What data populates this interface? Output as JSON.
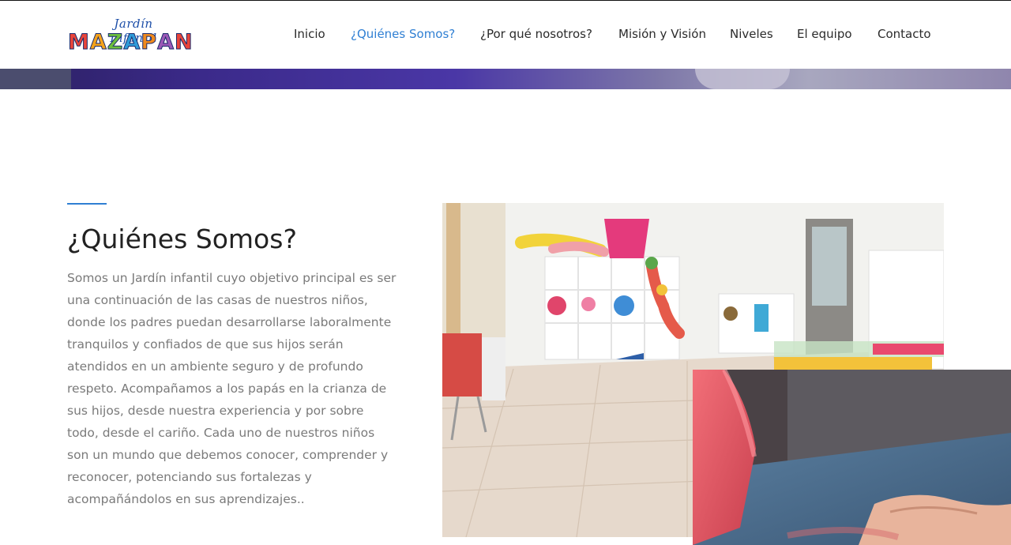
{
  "header": {
    "logo": {
      "tagline": "Jardín Infantil",
      "brand_letters": [
        {
          "char": "M",
          "color": "#e8443a"
        },
        {
          "char": "A",
          "color": "#f4a21b"
        },
        {
          "char": "Z",
          "color": "#6cbf3d"
        },
        {
          "char": "A",
          "color": "#2f9bd8"
        },
        {
          "char": "P",
          "color": "#f08a1e"
        },
        {
          "char": "A",
          "color": "#9b59b6"
        },
        {
          "char": "N",
          "color": "#e8443a"
        }
      ]
    },
    "nav": [
      {
        "label": "Inicio",
        "active": false
      },
      {
        "label": "¿Quiénes Somos?",
        "active": true
      },
      {
        "label": "¿Por qué nosotros?",
        "active": false
      },
      {
        "label": "Misión y Visión",
        "active": false
      },
      {
        "label": "Niveles",
        "active": false
      },
      {
        "label": "El equipo",
        "active": false
      },
      {
        "label": "Contacto",
        "active": false
      }
    ]
  },
  "about": {
    "title": "¿Quiénes Somos?",
    "body": "Somos un Jardín infantil cuyo objetivo principal es ser una continuación de las casas de nuestros niños, donde los padres puedan desarrollarse laboralmente tranquilos y confiados de que sus hijos serán atendidos en un ambiente seguro y de profundo respeto. Acompañamos a los papás en la crianza de sus hijos, desde nuestra experiencia y por sobre todo, desde el cariño. Cada uno de nuestros niños son un mundo que debemos conocer, comprender y reconocer, potenciando sus fortalezas y acompañándolos en sus aprendizajes.."
  },
  "colors": {
    "accent": "#2f7fd3",
    "text_muted": "#7a7a7a"
  }
}
